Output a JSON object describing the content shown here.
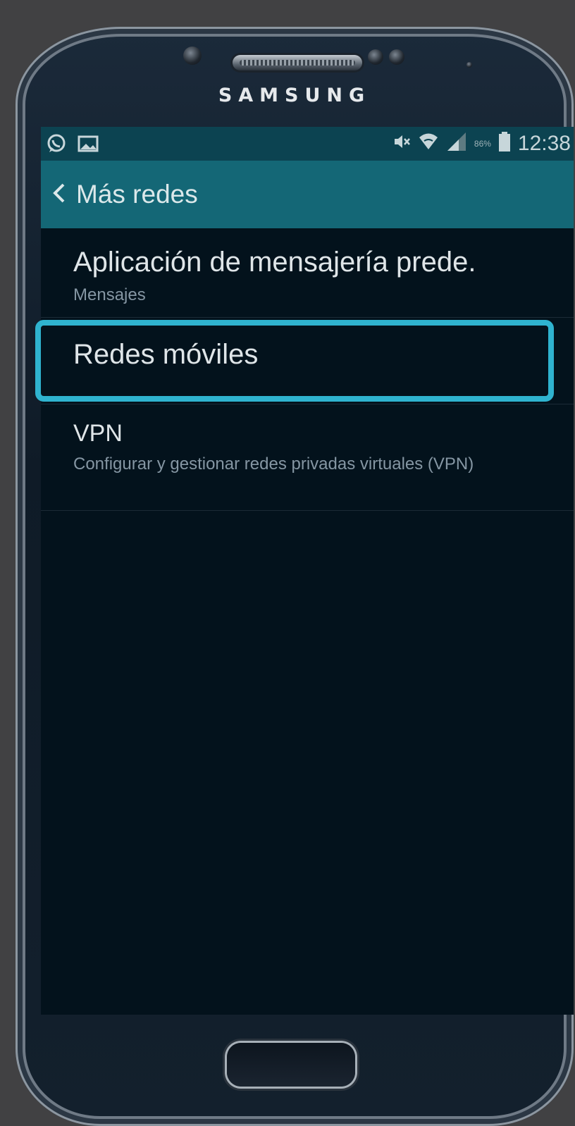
{
  "device": {
    "brand": "SAMSUNG"
  },
  "statusbar": {
    "time": "12:38",
    "battery_percent": "86%",
    "icons": [
      "whatsapp-icon",
      "gallery-icon",
      "mute-icon",
      "wifi-icon",
      "signal-icon",
      "battery-icon"
    ]
  },
  "header": {
    "title": "Más redes",
    "back_icon": "chevron-left-icon"
  },
  "settings_list": [
    {
      "title": "Aplicación de mensajería prede.",
      "subtitle": "Mensajes"
    },
    {
      "title": "Redes móviles",
      "highlighted": true
    },
    {
      "title": "VPN",
      "subtitle": "Configurar y gestionar redes privadas virtuales (VPN)"
    }
  ],
  "colors": {
    "statusbar_bg": "#0c4351",
    "titlebar_bg": "#146776",
    "screen_bg": "#03121c",
    "highlight": "#2fb3cf"
  }
}
